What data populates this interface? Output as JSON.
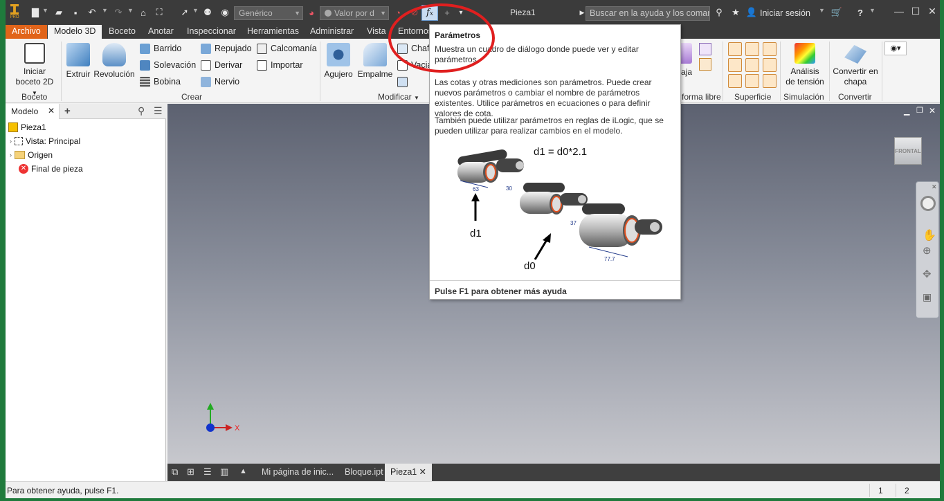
{
  "titlebar": {
    "app_badge": "PRO",
    "material_combo": "Genérico",
    "appearance_combo": "Valor por d",
    "title": "Pieza1",
    "help_search_placeholder": "Buscar en la ayuda y los comandos",
    "signin": "Iniciar sesión"
  },
  "tabs": [
    "Archivo",
    "Modelo 3D",
    "Boceto",
    "Anotar",
    "Inspeccionar",
    "Herramientas",
    "Administrar",
    "Vista",
    "Entornos"
  ],
  "ribbon": {
    "boceto_panel": {
      "label": "Boceto",
      "start_sketch_line1": "Iniciar",
      "start_sketch_line2": "boceto 2D"
    },
    "crear_panel": {
      "label": "Crear",
      "extrude": "Extruir",
      "revolve": "Revolución",
      "sweep": "Barrido",
      "loft": "Solevación",
      "coil": "Bobina",
      "emboss": "Repujado",
      "derive": "Derivar",
      "rib": "Nervio",
      "decal": "Calcomanía",
      "import": "Importar"
    },
    "modificar_panel": {
      "label": "Modificar",
      "hole": "Agujero",
      "fillet": "Empalme",
      "chamfer": "Chaf",
      "shell": "Vacia"
    },
    "forma_libre_panel": {
      "label": "forma libre",
      "box": "aja"
    },
    "superficie_panel": {
      "label": "Superficie"
    },
    "simulacion_panel": {
      "label": "Simulación",
      "stress_line1": "Análisis",
      "stress_line2": "de tensión"
    },
    "convertir_panel": {
      "label": "Convertir",
      "convert_line1": "Convertir en",
      "convert_line2": "chapa"
    }
  },
  "browser": {
    "tab_label": "Modelo",
    "items": [
      "Pieza1",
      "Vista: Principal",
      "Origen",
      "Final de pieza"
    ]
  },
  "tooltip": {
    "title": "Parámetros",
    "desc": "Muestra un cuadro de diálogo donde puede ver y editar parámetros.",
    "para1": "Las cotas y otras mediciones son parámetros. Puede crear nuevos parámetros o cambiar el nombre de parámetros existentes. Utilice parámetros en ecuaciones o para definir valores de cota.",
    "para2": "También puede utilizar parámetros en reglas de iLogic, que se pueden utilizar para realizar cambios en el modelo.",
    "equation": "d1 = d0*2.1",
    "label_d1": "d1",
    "label_d0": "d0",
    "dim_63": "63",
    "dim_30": "30",
    "dim_37": "37",
    "dim_777": "77.7",
    "footer": "Pulse F1 para obtener más ayuda"
  },
  "viewcube_label": "FRONTAL",
  "axis_x": "X",
  "doc_tabs": [
    "Mi página de inic...",
    "Bloque.ipt",
    "Pieza1"
  ],
  "status": {
    "text": "Para obtener ayuda, pulse F1.",
    "count1": "1",
    "count2": "2"
  },
  "colors": {
    "file_tab": "#e1641a",
    "titlebar": "#3b3b3b",
    "highlight": "#e01f1f"
  }
}
